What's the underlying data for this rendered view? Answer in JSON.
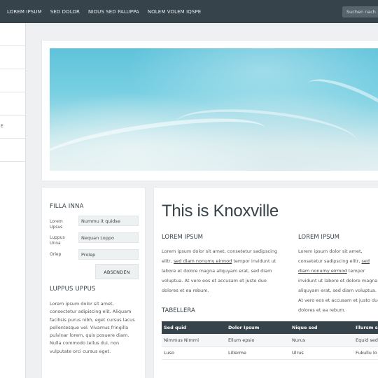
{
  "nav": {
    "items": [
      "LOREM IPSUM",
      "SED DOLOR",
      "NIOUS SED PALUPPA",
      "NOLEM VOLEM IQSPE"
    ],
    "search_placeholder": "Suchen nach"
  },
  "sidebar": {
    "items": [
      "",
      "",
      "",
      "",
      "E",
      ""
    ]
  },
  "hero": {
    "image": "beach-water-photo"
  },
  "form": {
    "title": "FILLA INNA",
    "fields": [
      {
        "label": "Lorem Upsus",
        "value": "Nummu it quidse"
      },
      {
        "label": "Luppus Unna",
        "value": "Nequan Loppo"
      },
      {
        "label": "Orlep",
        "value": "Prolep"
      }
    ],
    "submit_label": "ABSENDEN"
  },
  "side_text": {
    "title": "LUPPUS UPPUS",
    "body": "Lorem ipsum dolor sit amet, consectetur adipiscing elit. Aliquam facilisis purus nibh, eget cursus lacus pellentesque vel. Vivamus fringilla pulvinar lorem, quis posuere diam. Nulla commodo tellus dui, non vulputate orci cursus eget."
  },
  "main": {
    "title": "This is Knoxville",
    "col1": {
      "heading": "LOREM IPSUM",
      "text_a": "Lorem ipsum dolor sit amet, consetetur sadipscing elitr, ",
      "link": "sed diam nonumy eirmod",
      "text_b": " tempor invidunt ut labore et dolore magna aliquyam erat, sed diam voluptua. At vero eos et accusam et justo duo dolores et ea rebum."
    },
    "col2": {
      "heading": "LOREM IPSUM",
      "text_a": "Lorem ipsum dolor sit amet, consetetur sadipscing elitr, ",
      "link": "sed diam nonumy eirmod",
      "text_b": " tempor invidunt ut labore et dolore magna aliquyam erat, sed diam voluptua. At vero eos et accusam et justo duo dolores et ea rebum."
    },
    "table_title": "TABELLERA",
    "table": {
      "headers": [
        "Sed quid",
        "Dolor Ipsum",
        "Nique sed",
        "Illursm se"
      ],
      "rows": [
        [
          "Nimmus Nimmi",
          "Ellum epsio",
          "Nurus",
          "Equid sed"
        ],
        [
          "Luso",
          "Lillerme",
          "Ulrus",
          "Fukullu lo"
        ]
      ]
    }
  },
  "colors": {
    "navbar": "#37434a",
    "background": "#eef0f1",
    "card": "#ffffff",
    "table_header": "#37434a"
  }
}
